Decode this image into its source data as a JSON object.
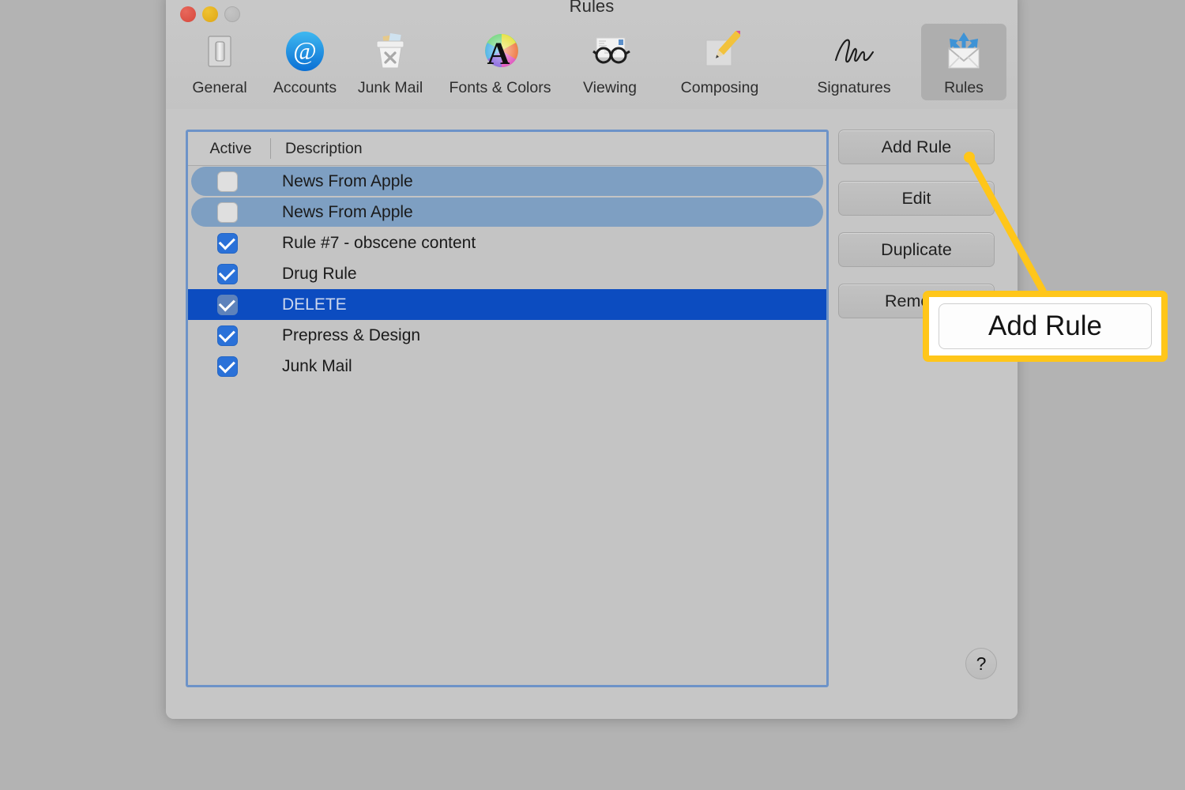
{
  "window": {
    "title": "Rules",
    "traffic_lights": [
      {
        "name": "close",
        "color": "#d6473b"
      },
      {
        "name": "minimize",
        "color": "#dfa615"
      },
      {
        "name": "zoom",
        "color": "#b6b6b6"
      }
    ]
  },
  "toolbar": {
    "items": [
      {
        "label": "General",
        "icon": "light-switch-icon",
        "selected": false
      },
      {
        "label": "Accounts",
        "icon": "at-sign-icon",
        "selected": false
      },
      {
        "label": "Junk Mail",
        "icon": "trash-can-icon",
        "selected": false
      },
      {
        "label": "Fonts & Colors",
        "icon": "color-wheel-a-icon",
        "selected": false
      },
      {
        "label": "Viewing",
        "icon": "glasses-letter-icon",
        "selected": false
      },
      {
        "label": "Composing",
        "icon": "pencil-note-icon",
        "selected": false
      },
      {
        "label": "Signatures",
        "icon": "signature-icon",
        "selected": false
      },
      {
        "label": "Rules",
        "icon": "envelope-arrows-icon",
        "selected": true
      }
    ]
  },
  "rules_table": {
    "columns": [
      "Active",
      "Description"
    ],
    "rows": [
      {
        "description": "News From Apple",
        "active": false,
        "highlight": "soft",
        "checkbox": "unchecked"
      },
      {
        "description": "News From Apple",
        "active": false,
        "highlight": "soft",
        "checkbox": "unchecked"
      },
      {
        "description": "Rule #7 - obscene content",
        "active": true,
        "highlight": "none",
        "checkbox": "checked"
      },
      {
        "description": "Drug Rule",
        "active": true,
        "highlight": "none",
        "checkbox": "checked"
      },
      {
        "description": "DELETE",
        "active": true,
        "highlight": "selected",
        "checkbox": "checked"
      },
      {
        "description": "Prepress & Design",
        "active": true,
        "highlight": "none",
        "checkbox": "checked"
      },
      {
        "description": "Junk Mail",
        "active": true,
        "highlight": "none",
        "checkbox": "checked"
      }
    ]
  },
  "side_buttons": [
    {
      "label": "Add Rule"
    },
    {
      "label": "Edit"
    },
    {
      "label": "Duplicate"
    },
    {
      "label": "Remove"
    }
  ],
  "help_button": {
    "glyph": "?"
  },
  "callout": {
    "label": "Add Rule",
    "border_color": "#ffc61a",
    "target": "add-rule-button"
  },
  "colors": {
    "desktop_background": "#b3b3b3",
    "window_background": "#c6c6c6",
    "list_focus_border": "#6d93c8",
    "row_soft_highlight": "#7e9fc2",
    "row_selected": "#0c4cc0",
    "checkbox_on": "#2a71d8",
    "callout_yellow": "#ffc61a"
  }
}
